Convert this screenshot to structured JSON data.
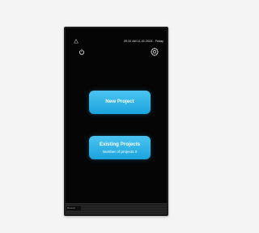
{
  "status_bar": {
    "datetime": "09:32 AM  11-01-2024 - Friday",
    "alert_icon": "warning-triangle-icon"
  },
  "toolbar": {
    "power_icon": "power-icon",
    "settings_icon": "gear-icon"
  },
  "main": {
    "new_project_label": "New Project",
    "existing_projects_label": "Existing Projects",
    "existing_projects_count": "Number of projects 0"
  },
  "footer": {
    "tag": "Mesonet"
  },
  "colors": {
    "accent": "#1aa3dc",
    "screen": "#050505",
    "frame": "#1c1c1c"
  }
}
